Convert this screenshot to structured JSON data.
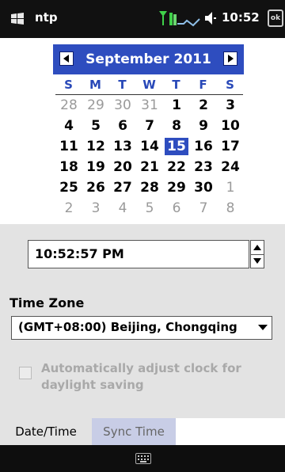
{
  "status": {
    "app_name": "ntp",
    "clock": "10:52",
    "ok_label": "ok"
  },
  "calendar": {
    "month_label": "September 2011",
    "weekdays": [
      "S",
      "M",
      "T",
      "W",
      "T",
      "F",
      "S"
    ],
    "days": [
      "28",
      "29",
      "30",
      "31",
      "1",
      "2",
      "3",
      "4",
      "5",
      "6",
      "7",
      "8",
      "9",
      "10",
      "11",
      "12",
      "13",
      "14",
      "15",
      "16",
      "17",
      "18",
      "19",
      "20",
      "21",
      "22",
      "23",
      "24",
      "25",
      "26",
      "27",
      "28",
      "29",
      "30",
      "1",
      "2",
      "3",
      "4",
      "5",
      "6",
      "7",
      "8"
    ],
    "selected_day": "15"
  },
  "time": {
    "value": "10:52:57 PM"
  },
  "timezone": {
    "label": "Time Zone",
    "selected": "(GMT+08:00) Beijing, Chongqing"
  },
  "dst": {
    "label": "Automatically adjust clock for daylight saving",
    "enabled": false,
    "checked": false
  },
  "tabs": [
    {
      "label": "Date/Time",
      "active": true
    },
    {
      "label": "Sync Time",
      "active": false
    }
  ],
  "colors": {
    "accent": "#2e4dbf",
    "panel": "#e3e3e3",
    "muted_text": "#9a9a9a"
  }
}
